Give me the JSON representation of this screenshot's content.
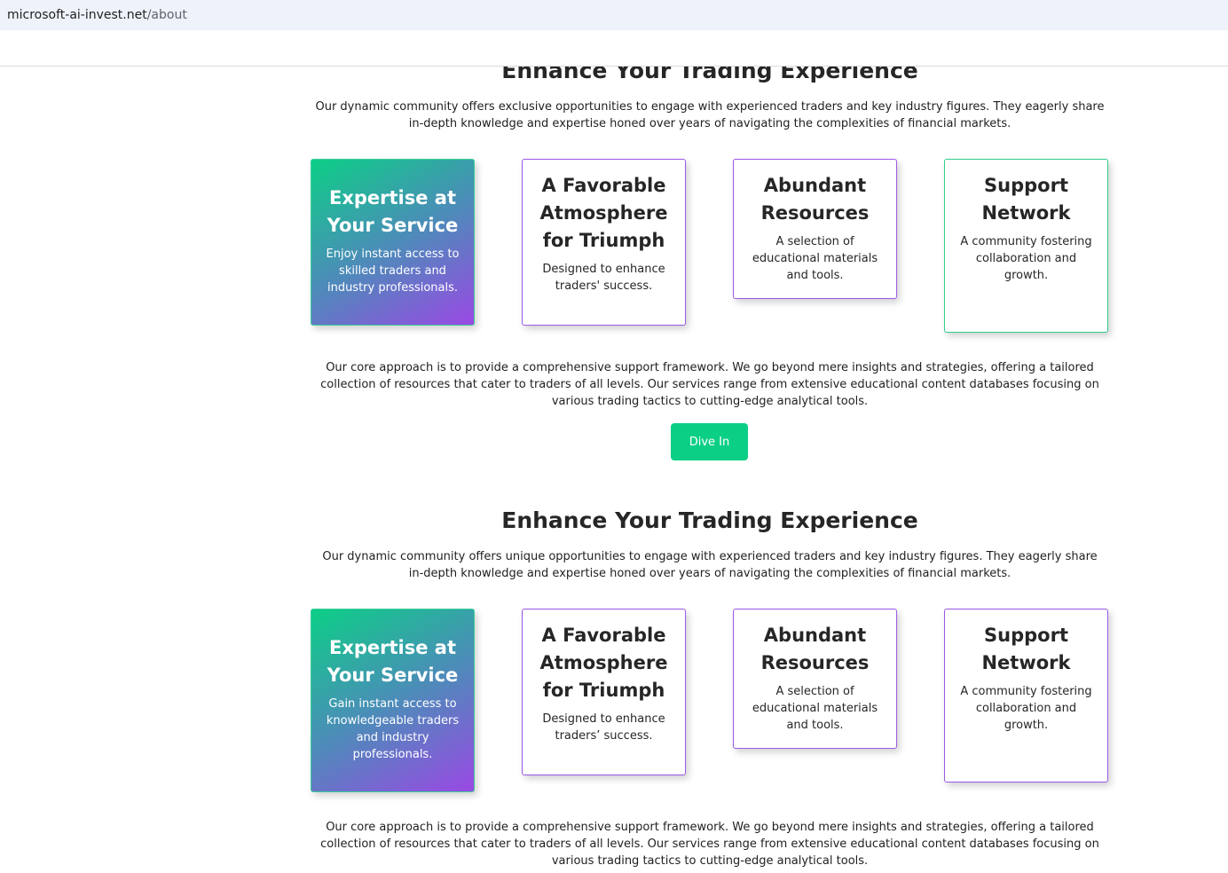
{
  "browser": {
    "url_host": "microsoft-ai-invest.net",
    "url_path": "/about"
  },
  "sections": [
    {
      "title": "Enhance Your Trading Experience",
      "description": "Our dynamic community offers exclusive opportunities to engage with experienced traders and key industry figures. They eagerly share in-depth knowledge and expertise honed over years of navigating the complexities of financial markets.",
      "cards": [
        {
          "title": "Expertise at Your Service",
          "text": "Enjoy instant access to skilled traders and industry professionals."
        },
        {
          "title": "A Favorable Atmosphere for Triumph",
          "text": "Designed to enhance traders' success."
        },
        {
          "title": "Abundant Resources",
          "text": "A selection of educational materials and tools."
        },
        {
          "title": "Support Network",
          "text": "A community fostering collaboration and growth."
        }
      ],
      "approach": "Our core approach is to provide a comprehensive support framework. We go beyond mere insights and strategies, offering a tailored collection of resources that cater to traders of all levels. Our services range from extensive educational content databases focusing on various trading tactics to cutting-edge analytical tools.",
      "button_label": "Dive In"
    },
    {
      "title": "Enhance Your Trading Experience",
      "description": "Our dynamic community offers unique opportunities to engage with experienced traders and key industry figures. They eagerly share in-depth knowledge and expertise honed over years of navigating the complexities of financial markets.",
      "cards": [
        {
          "title": "Expertise at Your Service",
          "text": "Gain instant access to knowledgeable traders and industry professionals."
        },
        {
          "title": "A Favorable Atmosphere for Triumph",
          "text": "Designed to enhance traders’ success."
        },
        {
          "title": "Abundant Resources",
          "text": "A selection of educational materials and tools."
        },
        {
          "title": "Support Network",
          "text": "A community fostering collaboration and growth."
        }
      ],
      "approach": "Our core approach is to provide a comprehensive support framework. We go beyond mere insights and strategies, offering a tailored collection of resources that cater to traders of all levels. Our services range from extensive educational content databases focusing on various trading tactics to cutting-edge analytical tools."
    }
  ],
  "colors": {
    "accent": "#0ccf86",
    "card_border_purple": "#9b59e8",
    "card_border_green": "#2fce8e",
    "gradient_end": "#9a49e4"
  }
}
